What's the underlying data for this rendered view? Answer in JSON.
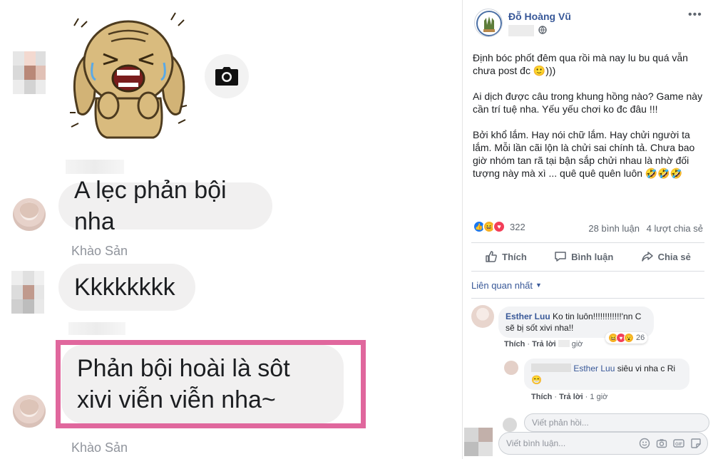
{
  "chat": {
    "sender_1": "Khào Sản",
    "sender_2": "Khào Sản",
    "messages": [
      {
        "text": "A lẹc phản bội nha"
      },
      {
        "text": "Kkkkkkkk"
      },
      {
        "text": "Phản bội hoài là sôt xivi viễn viễn nha~"
      }
    ],
    "colors": {
      "highlight": "#e0679d",
      "bubble": "#f1f0f0"
    }
  },
  "post": {
    "author": "Đỗ Hoàng Vũ",
    "menu": "•••",
    "paragraphs": [
      "Định bóc phốt đêm qua rồi mà nay lu bu quá vẫn chưa post đc 🙂)))",
      "Ai dịch được câu trong khung hồng nào? Game này cần trí tuệ nha. Yếu yếu chơi ko đc đâu !!!",
      "Bởi khổ lắm. Hay nói chữ lắm. Hay chửi người ta lắm. Mỗi lần cãi lộn là chửi sai chính tả. Chưa bao giờ nhóm tan rã tại bận sắp chửi nhau là nhờ đối tượng này mà xì ... quê quê quên luôn 🤣🤣🤣"
    ],
    "reactions": {
      "count": "322",
      "icons": [
        "like-icon",
        "haha-icon",
        "love-icon"
      ]
    },
    "stats": {
      "comments": "28 bình luận",
      "shares": "4 lượt chia sẻ"
    },
    "actions": {
      "like": "Thích",
      "comment": "Bình luận",
      "share": "Chia sẻ"
    },
    "sort_label": "Liên quan nhất",
    "comments": [
      {
        "name": "Esther Luu",
        "text": "Ko tin luôn!!!!!!!!!!!!'nn C sẽ bị sốt xivi nha!!",
        "reaction_count": "26",
        "like": "Thích",
        "reply": "Trả lời",
        "time": "giờ"
      }
    ],
    "reply": {
      "mention": "Esther Luu",
      "text": " siêu vi nha c Ri😁",
      "like": "Thích",
      "reply": "Trả lời",
      "time": "1 giờ"
    },
    "reply_placeholder": "Viết phản hồi...",
    "comment_placeholder": "Viết bình luận...",
    "colors": {
      "link": "#385898",
      "meta": "#606770",
      "like": "#1877f2",
      "love": "#f33e58",
      "haha": "#f7b125"
    }
  }
}
